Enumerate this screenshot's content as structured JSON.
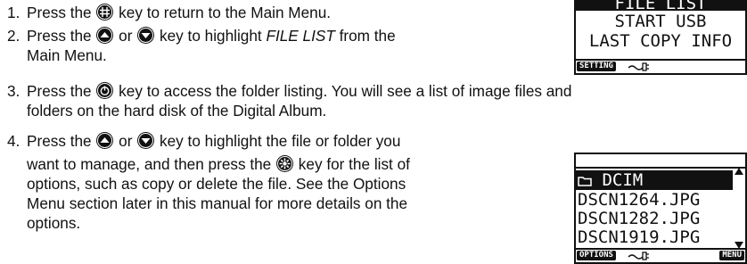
{
  "steps": [
    {
      "num": "1.",
      "lines": [
        "Press the",
        "key to return to the Main Menu."
      ]
    },
    {
      "num": "2.",
      "pre": "Press the",
      "mid": "or",
      "post": "key to highlight",
      "italic": "FILE LIST",
      "tail": "from the",
      "line2": "Main Menu."
    },
    {
      "num": "3.",
      "pre": "Press the",
      "post": "key to access the folder listing. You will see a list of image files and",
      "line2": "folders on the hard disk of the Digital Album."
    },
    {
      "num": "4.",
      "pre": "Press the",
      "mid": "or",
      "post": "key to highlight the file or folder you",
      "line2a": "want to manage, and then press the",
      "line2b": "key for the list of",
      "line3": "options, such as copy or delete the file. See the Options",
      "line4": "Menu section later in this manual for more details on the",
      "line5": "options."
    }
  ],
  "icons": {
    "menu_key": "menu-key-icon",
    "up_key": "up-arrow-key-icon",
    "down_key": "down-arrow-key-icon",
    "enter_key": "enter-key-icon",
    "options_key": "options-key-icon"
  },
  "screen1": {
    "rows": [
      "FILE LIST",
      "START USB",
      "LAST COPY INFO"
    ],
    "status_label": "SETTING"
  },
  "screen2": {
    "rows": [
      "DCIM",
      "DSCN1264.JPG",
      "DSCN1282.JPG",
      "DSCN1919.JPG"
    ],
    "status_left": "OPTIONS",
    "status_right": "MENU"
  }
}
